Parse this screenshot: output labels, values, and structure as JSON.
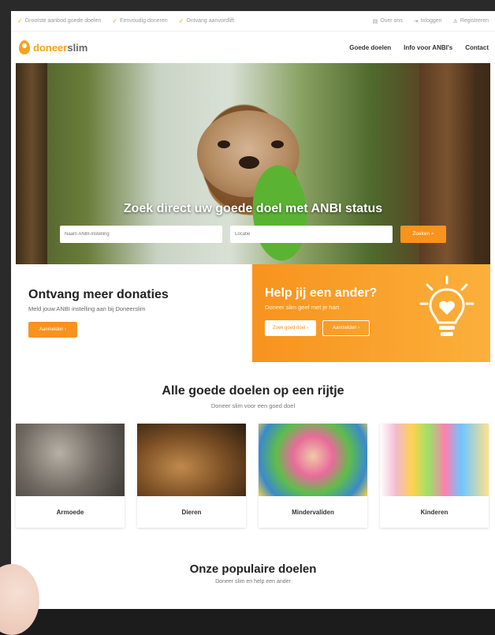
{
  "topbar": {
    "left": [
      {
        "icon": "check-icon",
        "label": "Grootste aanbod goede doelen"
      },
      {
        "icon": "check-icon",
        "label": "Eenvoudig doneren"
      },
      {
        "icon": "check-icon",
        "label": "Ontvang aanvordlift"
      }
    ],
    "right": [
      {
        "icon": "document-icon",
        "label": "Over ons"
      },
      {
        "icon": "login-icon",
        "label": "Inloggen"
      },
      {
        "icon": "user-icon",
        "label": "Registreren"
      }
    ]
  },
  "header": {
    "logo_a": "doneer",
    "logo_b": "slim",
    "nav": [
      "Goede doelen",
      "Info voor ANBI's",
      "Contact"
    ]
  },
  "hero": {
    "title": "Zoek direct uw goede doel met ANBI status",
    "search_placeholder": "Naam ANBI-instelling",
    "location_placeholder": "Locatie",
    "search_button": "Zoeken"
  },
  "promo": {
    "left_title": "Ontvang meer donaties",
    "left_sub": "Meld jouw ANBI instelling aan bij Doneerslim",
    "left_button": "Aanmelden",
    "right_title": "Help jij een ander?",
    "right_sub": "Doneer slim geef met je hart",
    "right_button1": "Zoek goed doel",
    "right_button2": "Aanmelden"
  },
  "categories_section": {
    "title": "Alle goede doelen op een rijtje",
    "subtitle": "Doneer slim voor een goed doel",
    "items": [
      "Armoede",
      "Dieren",
      "Mindervaliden",
      "Kinderen"
    ]
  },
  "popular_section": {
    "title": "Onze populaire doelen",
    "subtitle": "Doneer slim en help een ander"
  },
  "colors": {
    "accent": "#f7931e",
    "accent_light": "#fbb03b"
  }
}
